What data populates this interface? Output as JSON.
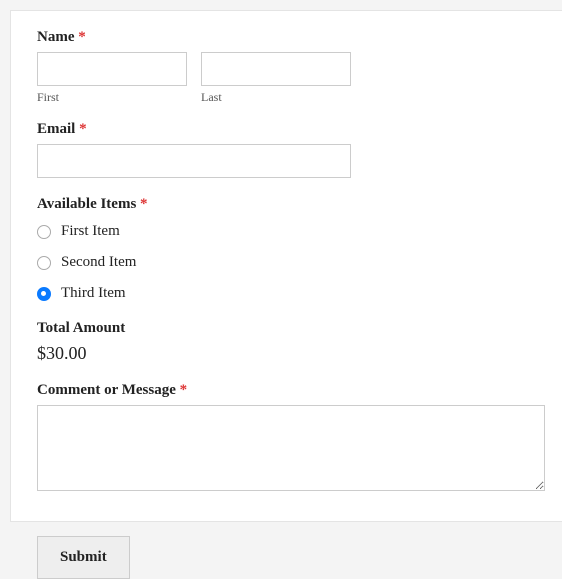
{
  "name": {
    "label": "Name",
    "req": "*",
    "first_sublabel": "First",
    "last_sublabel": "Last"
  },
  "email": {
    "label": "Email",
    "req": "*"
  },
  "items": {
    "label": "Available Items",
    "req": "*",
    "options": [
      {
        "label": "First Item",
        "selected": false
      },
      {
        "label": "Second Item",
        "selected": false
      },
      {
        "label": "Third Item",
        "selected": true
      }
    ]
  },
  "total": {
    "label": "Total Amount",
    "amount": "$30.00"
  },
  "comment": {
    "label": "Comment or Message",
    "req": "*"
  },
  "submit": {
    "label": "Submit"
  }
}
